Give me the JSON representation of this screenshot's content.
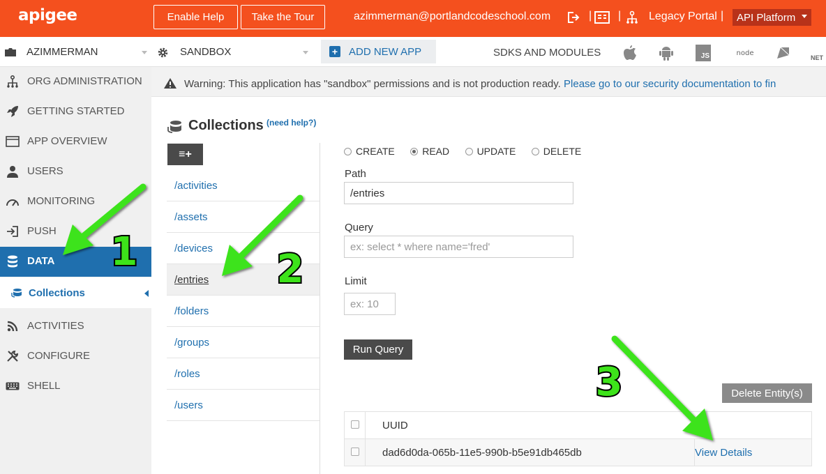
{
  "topbar": {
    "logo": "apigee",
    "enable_help": "Enable Help",
    "take_tour": "Take the Tour",
    "user_email": "azimmerman@portlandcodeschool.com",
    "legacy_portal": "Legacy Portal",
    "api_platform": "API Platform",
    "separators": [
      "|",
      "|",
      "|"
    ]
  },
  "subbar": {
    "org": "AZIMMERMAN",
    "app": "SANDBOX",
    "add_app": "ADD NEW APP",
    "sdks_label": "SDKS AND MODULES",
    "sdk_icons": [
      "apple-icon",
      "android-icon",
      "js-icon",
      "nodejs-icon",
      "ruby-icon",
      "dotnet-icon"
    ],
    "sdk_js_text": "JS",
    "sdk_node_text": "node",
    "sdk_net_text": "NET"
  },
  "sidebar": {
    "items": [
      {
        "label": "ORG ADMINISTRATION",
        "icon": "org-icon"
      },
      {
        "label": "GETTING STARTED",
        "icon": "rocket-icon"
      },
      {
        "label": "APP OVERVIEW",
        "icon": "window-icon"
      },
      {
        "label": "USERS",
        "icon": "user-icon"
      },
      {
        "label": "MONITORING",
        "icon": "gauge-icon"
      },
      {
        "label": "PUSH",
        "icon": "push-icon"
      },
      {
        "label": "DATA",
        "icon": "database-icon",
        "active": true
      },
      {
        "label": "ACTIVITIES",
        "icon": "rss-icon"
      },
      {
        "label": "CONFIGURE",
        "icon": "tools-icon"
      },
      {
        "label": "SHELL",
        "icon": "keyboard-icon"
      }
    ],
    "sub_item": "Collections"
  },
  "warning": {
    "text": "Warning: This application has \"sandbox\" permissions and is not production ready.",
    "link": "Please go to our security documentation to fin"
  },
  "collections": {
    "title": "Collections",
    "help": "(need help?)",
    "add_label": "≡+",
    "items": [
      "/activities",
      "/assets",
      "/devices",
      "/entries",
      "/folders",
      "/groups",
      "/roles",
      "/users"
    ],
    "selected": "/entries"
  },
  "query": {
    "operations": [
      "CREATE",
      "READ",
      "UPDATE",
      "DELETE"
    ],
    "selected_operation": "READ",
    "path_label": "Path",
    "path_value": "/entries",
    "query_label": "Query",
    "query_placeholder": "ex: select * where name='fred'",
    "limit_label": "Limit",
    "limit_placeholder": "ex: 10",
    "run_button": "Run Query"
  },
  "results": {
    "delete_button": "Delete Entity(s)",
    "header": "UUID",
    "rows": [
      {
        "uuid": "dad6d0da-065b-11e5-990b-b5e91db465db",
        "action": "View Details"
      }
    ]
  },
  "annotations": [
    "1",
    "2",
    "3"
  ],
  "colors": {
    "brand": "#f4501e",
    "active_nav": "#1f6fae",
    "link": "#1f6fae",
    "annotation": "#3de31a"
  }
}
